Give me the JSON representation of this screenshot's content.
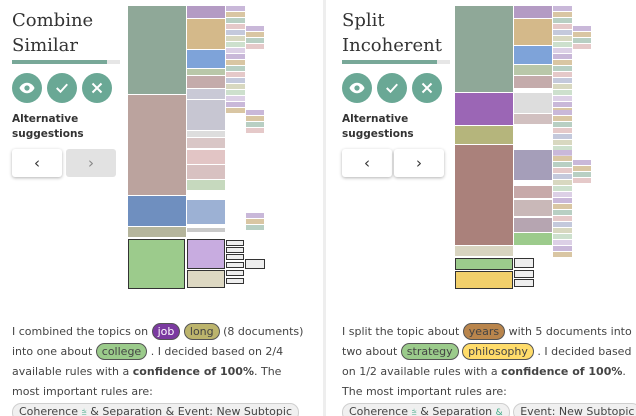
{
  "colors": {
    "teal": "#6aa895",
    "progress_fill": "#78a898",
    "job": "#7b3aa0",
    "long": "#bcb46c",
    "college": "#9bcb8b",
    "years": "#b9854c",
    "strategy": "#9bcb8b",
    "philosophy": "#ffdc6a"
  },
  "left": {
    "title": "Combine Similar",
    "progress_fraction": 0.88,
    "buttons": {
      "view_icon": "eye-icon",
      "accept_icon": "check-icon",
      "reject_icon": "close-icon"
    },
    "alternatives_label": "Alternative suggestions",
    "prev_label": "‹",
    "next_label": "›",
    "description": {
      "intro": "I combined the topics on",
      "word_1": "job",
      "word_2": "long",
      "doc_count": "(8 documents) into one about",
      "target": "college",
      "rules_prefix": ". I decided based on 2/4 available rules with a",
      "confidence": "confidence of 100%",
      "rules_suffix": ". The most important rules are:",
      "rule_chip": "Coherence",
      "rule_chip_rest": "& Separation",
      "rule_chip_end": "& Event: New Subtopic"
    }
  },
  "right": {
    "title": "Split Incoherent",
    "progress_fraction": 0.88,
    "buttons": {
      "view_icon": "eye-icon",
      "accept_icon": "check-icon",
      "reject_icon": "close-icon"
    },
    "alternatives_label": "Alternative suggestions",
    "prev_label": "‹",
    "next_label": "›",
    "description": {
      "intro": "I split the topic about",
      "word_1": "years",
      "middle": "with 5 documents into two about",
      "target_1": "strategy",
      "target_2": "philosophy",
      "rules_prefix": ". I decided based on 1/2 available rules with a",
      "confidence": "confidence of 100%",
      "rules_suffix": ". The most important rules are:",
      "rule_chip": "Coherence",
      "rule_chip_rest": "& Separation",
      "rule_chip_end": "Event: New Subtopic"
    }
  }
}
